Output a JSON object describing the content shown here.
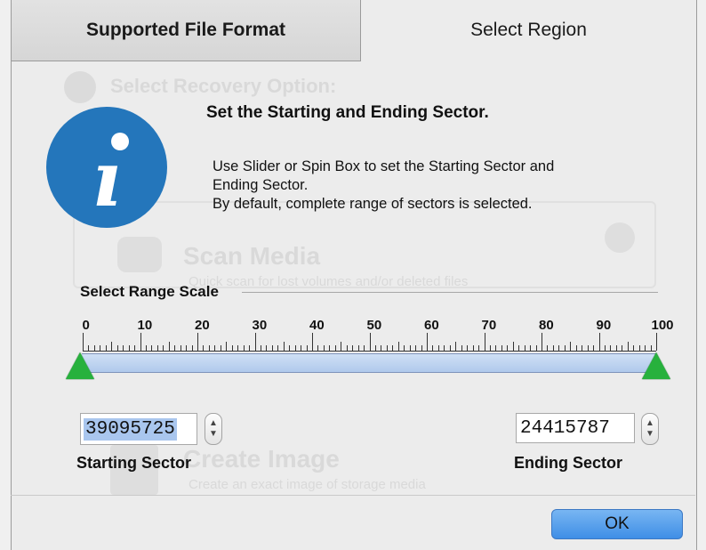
{
  "tabs": [
    {
      "label": "Supported File Format",
      "active": false
    },
    {
      "label": "Select Region",
      "active": true
    }
  ],
  "background_ghost": {
    "title": "Select Recovery Option:",
    "scan_media": "Scan Media",
    "scan_media_desc": "Quick scan for lost volumes and/or deleted files",
    "create_image": "Create Image",
    "create_image_desc": "Create an exact image of storage media"
  },
  "info": {
    "icon": "info-icon",
    "heading": "Set the Starting and Ending Sector.",
    "description": [
      "Use Slider or Spin Box to set the Starting Sector and",
      "Ending Sector.",
      "By default, complete range of sectors is selected."
    ]
  },
  "range": {
    "label": "Select Range Scale",
    "ticks": [
      "0",
      "10",
      "20",
      "30",
      "40",
      "50",
      "60",
      "70",
      "80",
      "90",
      "100"
    ],
    "start_percent": 0,
    "end_percent": 100
  },
  "start_sector": {
    "value": "39095725",
    "label": "Starting Sector"
  },
  "end_sector": {
    "value": "24415787",
    "label": "Ending Sector"
  },
  "buttons": {
    "ok": "OK"
  },
  "colors": {
    "info_icon": "#2476bb",
    "handle": "#27b13d",
    "ok_button": "#4a97ea"
  }
}
